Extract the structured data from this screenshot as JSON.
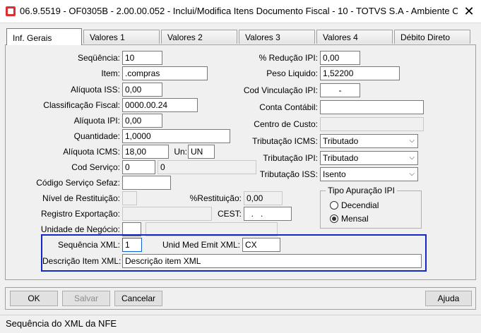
{
  "window": {
    "title": "06.9.5519 - OF0305B - 2.00.00.052 - Inclui/Modifica Itens Documento Fiscal - 10 - TOTVS S.A - Ambiente Corporativo...",
    "close_glyph": "✕"
  },
  "tabs": [
    {
      "label": "Inf. Gerais",
      "active": true
    },
    {
      "label": "Valores 1"
    },
    {
      "label": "Valores 2"
    },
    {
      "label": "Valores 3"
    },
    {
      "label": "Valores 4"
    },
    {
      "label": "Débito Direto"
    }
  ],
  "form": {
    "sequencia": {
      "label": "Seqüência:",
      "value": "10"
    },
    "item": {
      "label": "Item:",
      "value": ".compras"
    },
    "aliquota_iss": {
      "label": "Alíquota ISS:",
      "value": "0,00"
    },
    "classificacao_fiscal": {
      "label": "Classificação Fiscal:",
      "value": "0000.00.24"
    },
    "aliquota_ipi": {
      "label": "Alíquota IPI:",
      "value": "0,00"
    },
    "quantidade": {
      "label": "Quantidade:",
      "value": "1,0000"
    },
    "aliquota_icms": {
      "label": "Alíquota ICMS:",
      "value": "18,00"
    },
    "un": {
      "label": "Un:",
      "value": "UN"
    },
    "cod_servico": {
      "label": "Cod Serviço:",
      "value": "0",
      "desc": "0"
    },
    "cod_servico_sefaz": {
      "label": "Código Serviço Sefaz:",
      "value": ""
    },
    "nivel_restituicao": {
      "label": "Nível de Restituição:",
      "value": ""
    },
    "registro_exportacao": {
      "label": "Registro Exportação:",
      "value": ""
    },
    "unidade_negocio": {
      "label": "Unidade de Negócio:",
      "value": "",
      "desc": ""
    },
    "perc_reducao_ipi": {
      "label": "% Redução IPI:",
      "value": "0,00"
    },
    "peso_liquido": {
      "label": "Peso Liquido:",
      "value": "1,52200"
    },
    "cod_vinculacao_ipi": {
      "label": "Cod Vinculação IPI:",
      "value": "-"
    },
    "conta_contabil": {
      "label": "Conta Contábil:",
      "value": ""
    },
    "centro_custo": {
      "label": "Centro de Custo:",
      "value": ""
    },
    "tributacao_icms": {
      "label": "Tributação ICMS:",
      "value": "Tributado"
    },
    "tributacao_ipi": {
      "label": "Tributação IPI:",
      "value": "Tributado"
    },
    "tributacao_iss": {
      "label": "Tributação ISS:",
      "value": "Isento"
    },
    "perc_restituicao": {
      "label": "%Restituição:",
      "value": "0,00"
    },
    "cest": {
      "label": "CEST:",
      "value": "  .   ."
    },
    "tipo_apuracao_ipi": {
      "title": "Tipo Apuração IPI",
      "options": [
        {
          "label": "Decendial",
          "selected": false
        },
        {
          "label": "Mensal",
          "selected": true
        }
      ]
    },
    "sequencia_xml": {
      "label": "Sequência XML:",
      "value": "1"
    },
    "unid_med_emit_xml": {
      "label": "Unid Med Emit XML:",
      "value": "CX"
    },
    "descricao_item_xml": {
      "label": "Descrição Item XML:",
      "value": "Descrição item XML"
    }
  },
  "buttons": {
    "ok": "OK",
    "salvar": "Salvar",
    "cancelar": "Cancelar",
    "ajuda": "Ajuda"
  },
  "status": {
    "text": "Sequência do XML da NFE"
  },
  "colors": {
    "highlight": "#1428c8",
    "app_icon": "#dc2e2e"
  }
}
